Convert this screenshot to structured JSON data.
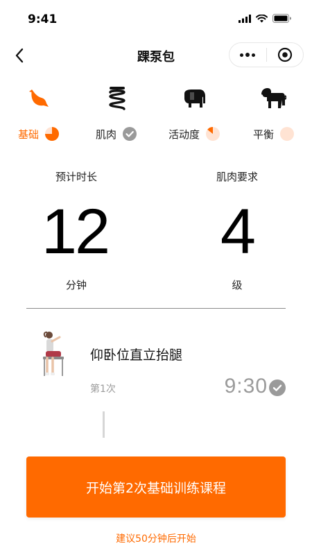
{
  "status_bar": {
    "time": "9:41",
    "icons": [
      "signal-icon",
      "wifi-icon",
      "battery-icon"
    ]
  },
  "nav": {
    "title": "踝泵包",
    "back_icon": "chevron-left-icon",
    "more_icon": "more-dots-icon",
    "close_icon": "target-close-icon"
  },
  "levels": [
    {
      "icon": "bird-icon",
      "label": "基础",
      "active": true,
      "progress": 0.75,
      "status": "pie"
    },
    {
      "icon": "spring-icon",
      "label": "肌肉",
      "active": false,
      "progress": 1.0,
      "status": "check"
    },
    {
      "icon": "elephant-icon",
      "label": "活动度",
      "active": false,
      "progress": 0.1,
      "status": "pie"
    },
    {
      "icon": "lion-icon",
      "label": "平衡",
      "active": false,
      "progress": 0,
      "status": "pie"
    }
  ],
  "stats": {
    "duration_label": "预计时长",
    "duration_value": "12",
    "duration_unit": "分钟",
    "muscle_label": "肌肉要求",
    "muscle_value": "4",
    "muscle_unit": "级"
  },
  "exercise": {
    "name": "仰卧位直立抬腿",
    "count": "第1次",
    "time": "9:30",
    "status": "check"
  },
  "action": {
    "start_label": "开始第2次基础训练课程",
    "hint": "建议50分钟后开始"
  },
  "colors": {
    "accent": "#ff6a00",
    "muted": "#9a9a9a",
    "peach": "#ffe3d3"
  }
}
